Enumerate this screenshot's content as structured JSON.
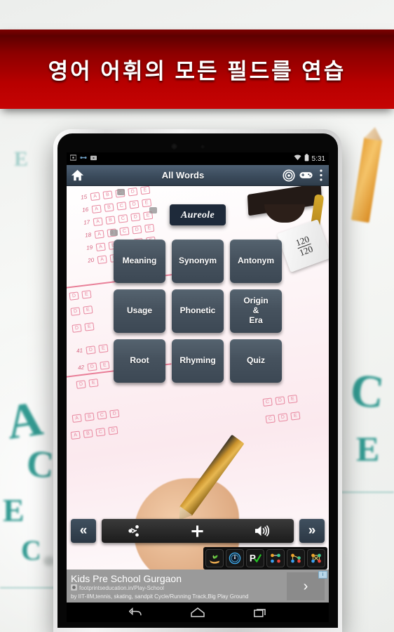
{
  "banner": {
    "headline": "영어 어휘의 모든 필드를 연습",
    "bg_color_dark": "#5d0000",
    "bg_color_bright": "#c60404"
  },
  "device": {
    "type": "android-tablet",
    "bezel_color": "#070707",
    "frame_color": "#dcdcdc"
  },
  "status_bar": {
    "clock": "5:31",
    "left_icons": [
      "screenshot-icon",
      "usb-debug-icon",
      "camera-icon"
    ],
    "right_icons": [
      "wifi-icon",
      "battery-icon"
    ]
  },
  "action_bar": {
    "title": "All Words",
    "home_icon": "home-icon",
    "target_icon": "target-icon",
    "game_icon": "gamepad-icon",
    "overflow_icon": "overflow-menu-icon",
    "bg_color": "#3b4b5c"
  },
  "word_card": {
    "word": "Aureole",
    "bg_color": "#1e2a3a"
  },
  "grid": {
    "tile_color": "#46525e",
    "tiles": [
      {
        "label": "Meaning"
      },
      {
        "label": "Synonym"
      },
      {
        "label": "Antonym"
      },
      {
        "label": "Usage"
      },
      {
        "label": "Phonetic"
      },
      {
        "label": "Origin\n&\nEra"
      },
      {
        "label": "Root"
      },
      {
        "label": "Rhyming"
      },
      {
        "label": "Quiz"
      }
    ]
  },
  "nav_row": {
    "prev_label": "«",
    "next_label": "»",
    "media_buttons": [
      {
        "name": "share-icon"
      },
      {
        "name": "add-icon"
      },
      {
        "name": "speaker-icon"
      }
    ]
  },
  "icon_strip": [
    {
      "name": "sprout-hand-icon"
    },
    {
      "name": "compass-icon"
    },
    {
      "name": "parking-check-icon"
    },
    {
      "name": "node-graph-icon-1"
    },
    {
      "name": "node-graph-icon-2"
    },
    {
      "name": "node-graph-icon-3"
    }
  ],
  "ad": {
    "headline": "Kids Pre School Gurgaon",
    "url": "footprintseducation.in/Play-School",
    "description": "by IIT-IIM,tennis, skating, sandpit Cycle/Running Track,Big Play Ground",
    "arrow": "›",
    "adchoices_label": "i"
  },
  "android_nav": {
    "back_icon": "back-icon",
    "home_icon": "home-outline-icon",
    "recents_icon": "recents-icon"
  },
  "scroll_prop": {
    "numerator": "120",
    "denominator": "120"
  }
}
